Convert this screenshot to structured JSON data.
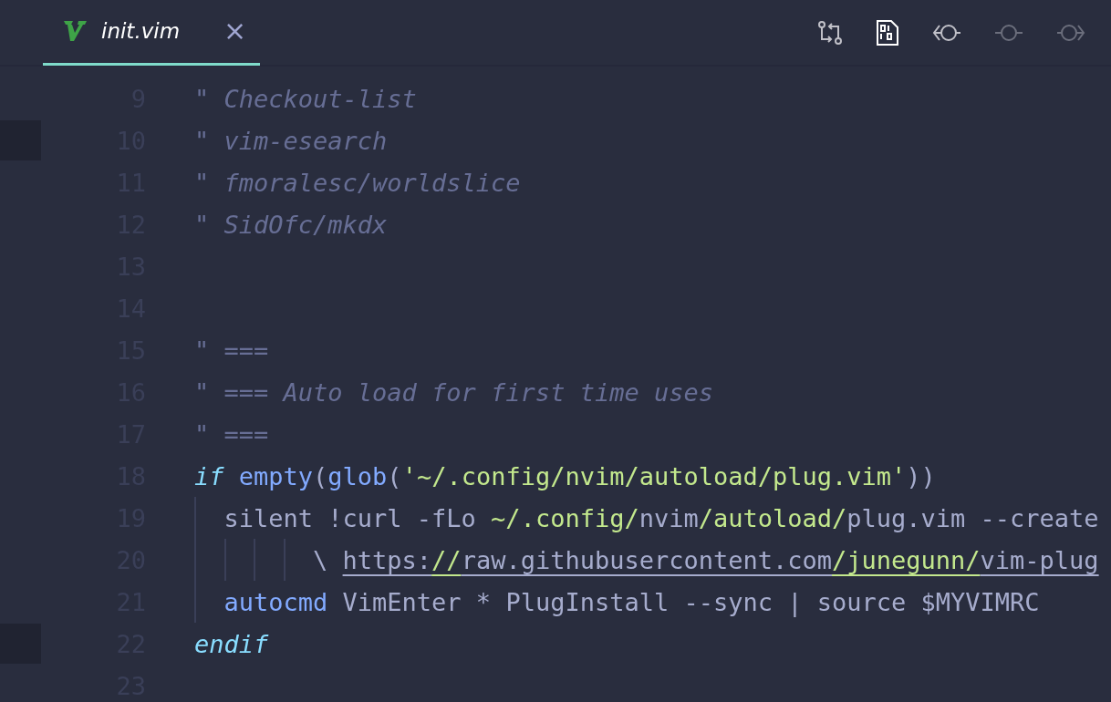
{
  "tab": {
    "label": "init.vim",
    "selected": true,
    "close": "×"
  },
  "toolbar": [
    {
      "kind": "compare",
      "selected": false,
      "disabled": false
    },
    {
      "kind": "binary",
      "selected": true,
      "disabled": false
    },
    {
      "kind": "prev-commit",
      "selected": false,
      "disabled": false
    },
    {
      "kind": "commit",
      "selected": false,
      "disabled": true
    },
    {
      "kind": "next-commit",
      "selected": false,
      "disabled": true
    }
  ],
  "lines": [
    {
      "number": "9",
      "marked": false,
      "segments": [
        {
          "kind": "comment",
          "text": "\" Checkout-list"
        }
      ]
    },
    {
      "number": "10",
      "marked": true,
      "segments": [
        {
          "kind": "comment",
          "text": "\" vim-esearch"
        }
      ]
    },
    {
      "number": "11",
      "marked": false,
      "segments": [
        {
          "kind": "comment",
          "text": "\" fmoralesc/worldslice"
        }
      ]
    },
    {
      "number": "12",
      "marked": false,
      "segments": [
        {
          "kind": "comment",
          "text": "\" SidOfc/mkdx"
        }
      ]
    },
    {
      "number": "13",
      "marked": false
    },
    {
      "number": "14",
      "marked": false
    },
    {
      "number": "15",
      "marked": false,
      "segments": [
        {
          "kind": "comment",
          "text": "\" ==="
        }
      ]
    },
    {
      "number": "16",
      "marked": false,
      "segments": [
        {
          "kind": "comment",
          "text": "\" === Auto load for first time uses"
        }
      ]
    },
    {
      "number": "17",
      "marked": false,
      "segments": [
        {
          "kind": "comment",
          "text": "\" ==="
        }
      ]
    },
    {
      "number": "18",
      "marked": false,
      "segments": [
        {
          "kind": "keyword",
          "text": "if"
        },
        {
          "kind": "func",
          "text": " empty"
        },
        {
          "kind": "punct",
          "text": "("
        },
        {
          "kind": "func",
          "text": "glob"
        },
        {
          "kind": "punct",
          "text": "("
        },
        {
          "kind": "string",
          "text": "'~/.config/nvim/autoload/plug.vim'"
        },
        {
          "kind": "punct",
          "text": "))"
        }
      ]
    },
    {
      "number": "19",
      "marked": false,
      "segments": [
        {
          "kind": "plain",
          "text": "  silent !curl -fLo "
        },
        {
          "kind": "string",
          "text": "~/.config/"
        },
        {
          "kind": "plain",
          "text": "nvim"
        },
        {
          "kind": "string",
          "text": "/autoload/"
        },
        {
          "kind": "plain",
          "text": "plug.vim --create"
        }
      ]
    },
    {
      "number": "20",
      "marked": false,
      "segments": [
        {
          "kind": "plain",
          "text": "        \\ "
        },
        {
          "kind": "link",
          "text": "https:"
        },
        {
          "kind": "link-string",
          "text": "//"
        },
        {
          "kind": "link",
          "text": "raw.githubusercontent.com"
        },
        {
          "kind": "link-string",
          "text": "/junegunn/"
        },
        {
          "kind": "link",
          "text": "vim-plug"
        }
      ]
    },
    {
      "number": "21",
      "marked": false,
      "segments": [
        {
          "kind": "func",
          "text": "  autocmd"
        },
        {
          "kind": "plain",
          "text": " VimEnter * PlugInstall --sync | source $MYVIMRC"
        }
      ]
    },
    {
      "number": "22",
      "marked": true,
      "segments": [
        {
          "kind": "keyword",
          "text": "endif"
        }
      ]
    },
    {
      "number": "23",
      "marked": false
    }
  ]
}
